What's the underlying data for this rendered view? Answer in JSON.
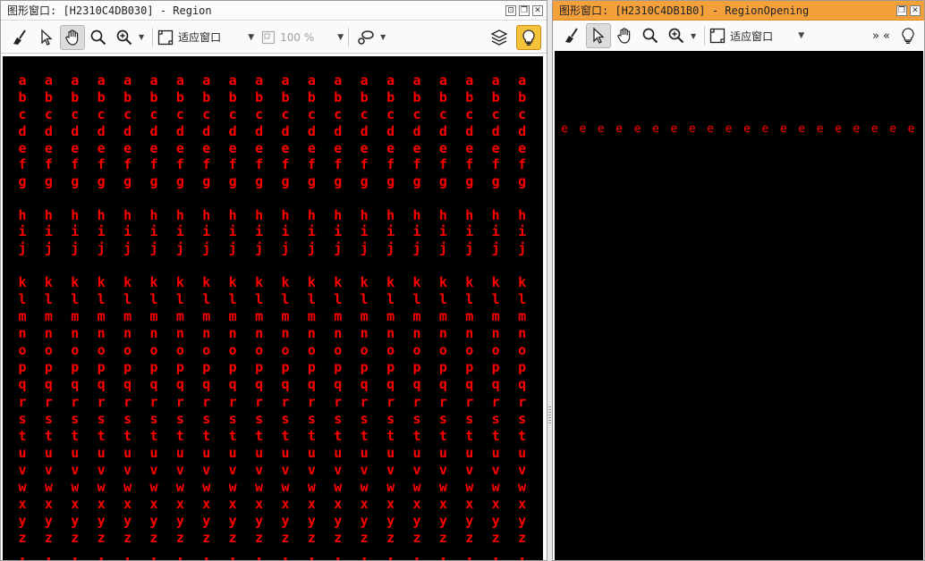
{
  "left_window": {
    "title": "图形窗口: [H2310C4DB030] - Region",
    "zoom_label": "适应窗口",
    "zoom_percent": "100 %",
    "letter_rows": [
      "a",
      "b",
      "c",
      "d",
      "e",
      "f",
      "g",
      "h",
      "i",
      "j",
      "k",
      "l",
      "m",
      "n",
      "o",
      "p",
      "q",
      "r",
      "s",
      "t",
      "u",
      "v",
      "w",
      "x",
      "y",
      "z"
    ],
    "letters_per_row": 20
  },
  "right_window": {
    "title": "图形窗口: [H2310C4DB1B0] - RegionOpening",
    "zoom_label": "适应窗口",
    "overflow_label": "» «",
    "letter_rows": [
      "e"
    ],
    "letters_per_row": 20
  },
  "colors": {
    "region": "#ff0000",
    "background": "#000000",
    "active_title": "#f4a13c"
  },
  "icons": {
    "clear": "broom-icon",
    "pointer": "arrow-cursor-icon",
    "pan": "hand-icon",
    "zoom": "magnifier-icon",
    "zoom_in": "magnifier-plus-icon",
    "fit": "fit-window-icon",
    "draw": "lasso-icon",
    "layers": "layers-icon",
    "feedback": "lightbulb-icon"
  }
}
